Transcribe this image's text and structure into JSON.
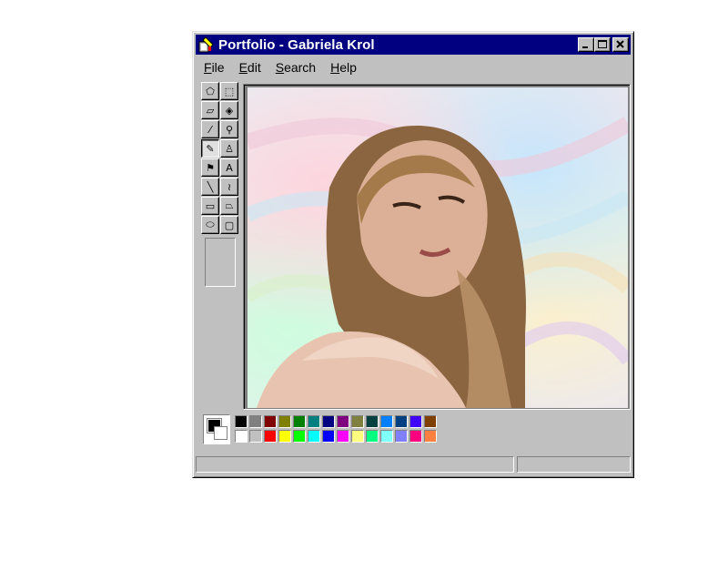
{
  "window": {
    "title": "Portfolio - Gabriela Krol",
    "accent": "#000080",
    "face_color": "#c0c0c0"
  },
  "title_buttons": [
    {
      "name": "minimize-button",
      "icon": "minimize-icon"
    },
    {
      "name": "maximize-button",
      "icon": "maximize-icon"
    },
    {
      "name": "close-button",
      "icon": "close-icon"
    }
  ],
  "menu": [
    {
      "accel": "F",
      "rest": "ile"
    },
    {
      "accel": "E",
      "rest": "dit"
    },
    {
      "accel": "S",
      "rest": "earch"
    },
    {
      "accel": "H",
      "rest": "elp"
    }
  ],
  "tools": [
    {
      "name": "free-form-select-tool",
      "glyph": "⬠",
      "pressed": false
    },
    {
      "name": "rect-select-tool",
      "glyph": "⬚",
      "pressed": false
    },
    {
      "name": "eraser-tool",
      "glyph": "▱",
      "pressed": false
    },
    {
      "name": "fill-tool",
      "glyph": "◈",
      "pressed": false
    },
    {
      "name": "pick-color-tool",
      "glyph": "⁄",
      "pressed": false
    },
    {
      "name": "magnifier-tool",
      "glyph": "⚲",
      "pressed": false
    },
    {
      "name": "pencil-tool",
      "glyph": "✎",
      "pressed": true
    },
    {
      "name": "brush-tool",
      "glyph": "♙",
      "pressed": false
    },
    {
      "name": "airbrush-tool",
      "glyph": "⚑",
      "pressed": false
    },
    {
      "name": "text-tool",
      "glyph": "A",
      "pressed": false
    },
    {
      "name": "line-tool",
      "glyph": "╲",
      "pressed": false
    },
    {
      "name": "curve-tool",
      "glyph": "≀",
      "pressed": false
    },
    {
      "name": "rectangle-tool",
      "glyph": "▭",
      "pressed": false
    },
    {
      "name": "polygon-tool",
      "glyph": "⏢",
      "pressed": false
    },
    {
      "name": "ellipse-tool",
      "glyph": "⬭",
      "pressed": false
    },
    {
      "name": "rounded-rect-tool",
      "glyph": "▢",
      "pressed": false
    }
  ],
  "palette": {
    "foreground": "#000000",
    "background": "#ffffff",
    "row1": [
      "#000000",
      "#808080",
      "#800000",
      "#808000",
      "#008000",
      "#008080",
      "#000080",
      "#800080",
      "#808040",
      "#004040",
      "#0080ff",
      "#004080",
      "#4000ff",
      "#804000"
    ],
    "row2": [
      "#ffffff",
      "#c0c0c0",
      "#ff0000",
      "#ffff00",
      "#00ff00",
      "#00ffff",
      "#0000ff",
      "#ff00ff",
      "#ffff80",
      "#00ff80",
      "#80ffff",
      "#8080ff",
      "#ff0080",
      "#ff8040"
    ]
  },
  "status": {
    "left": "",
    "right": ""
  }
}
